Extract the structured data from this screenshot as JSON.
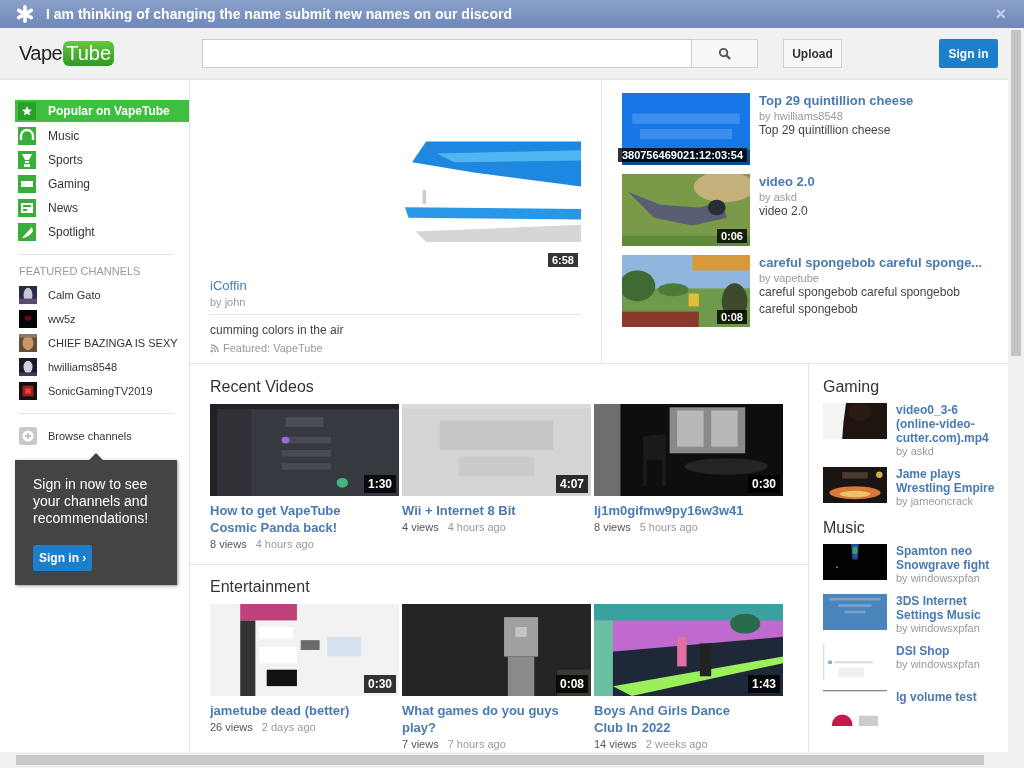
{
  "banner": {
    "text": "I am thinking of changing the name submit new names on our discord",
    "close": "×"
  },
  "header": {
    "logo": {
      "first": "Vape",
      "second": "Tube"
    },
    "upload": "Upload",
    "sign_in": "Sign in"
  },
  "sidebar": {
    "nav": [
      {
        "label": "Popular on VapeTube",
        "selected": true
      },
      {
        "label": "Music",
        "selected": false
      },
      {
        "label": "Sports",
        "selected": false
      },
      {
        "label": "Gaming",
        "selected": false
      },
      {
        "label": "News",
        "selected": false
      },
      {
        "label": "Spotlight",
        "selected": false
      }
    ],
    "featured_heading": "FEATURED CHANNELS",
    "channels": [
      "Calm Gato",
      "ww5z",
      "CHIEF BAZINGA IS SEXY",
      "hwilliams8548",
      "SonicGamingTV2019"
    ],
    "browse": "Browse channels",
    "promo": {
      "text": "Sign in now to see your channels and recommendations!",
      "button": "Sign in ›"
    }
  },
  "featured": {
    "main": {
      "duration": "6:58",
      "title": "iCoffin",
      "by": "by john",
      "description": "cumming colors in the air",
      "source": "Featured: VapeTube"
    },
    "side": [
      {
        "duration": "380756469021:12:03:54",
        "title": "Top 29 quintillion cheese",
        "by": "by hwilliams8548",
        "description": "Top 29 quintillion cheese"
      },
      {
        "duration": "0:06",
        "title": "video 2.0",
        "by": "by askd",
        "description": "video 2.0"
      },
      {
        "duration": "0:08",
        "title": "careful spongebob careful sponge...",
        "by": "by vapetube",
        "description": "careful spongebob careful spongebob careful spongebob"
      }
    ]
  },
  "sections": [
    {
      "title": "Recent Videos",
      "videos": [
        {
          "duration": "1:30",
          "title": "How to get VapeTube Cosmic Panda back!",
          "views": "8 views",
          "age": "4 hours ago"
        },
        {
          "duration": "4:07",
          "title": "Wii + Internet 8 Bit",
          "views": "4 views",
          "age": "4 hours ago"
        },
        {
          "duration": "0:30",
          "title": "lj1m0gifmw9py16w3w41",
          "views": "8 views",
          "age": "5 hours ago"
        }
      ]
    },
    {
      "title": "Entertainment",
      "videos": [
        {
          "duration": "0:30",
          "title": "jametube dead (better)",
          "views": "26 views",
          "age": "2 days ago"
        },
        {
          "duration": "0:08",
          "title": "What games do you guys play?",
          "views": "7 views",
          "age": "7 hours ago"
        },
        {
          "duration": "1:43",
          "title": "Boys And Girls Dance Club In 2022",
          "views": "14 views",
          "age": "2 weeks ago"
        }
      ]
    }
  ],
  "right": [
    {
      "title": "Gaming",
      "videos": [
        {
          "title": "video0_3-6 (online-video-cutter.com).mp4",
          "by": "by askd"
        },
        {
          "title": "Jame plays Wrestling Empire",
          "by": "by jameoncrack"
        }
      ]
    },
    {
      "title": "Music",
      "videos": [
        {
          "title": "Spamton neo Snowgrave fight",
          "by": "by windowsxpfan"
        },
        {
          "title": "3DS Internet Settings Music",
          "by": "by windowsxpfan"
        },
        {
          "title": "DSI Shop",
          "by": "by windowsxpfan"
        },
        {
          "title": "lg volume test"
        }
      ]
    }
  ]
}
